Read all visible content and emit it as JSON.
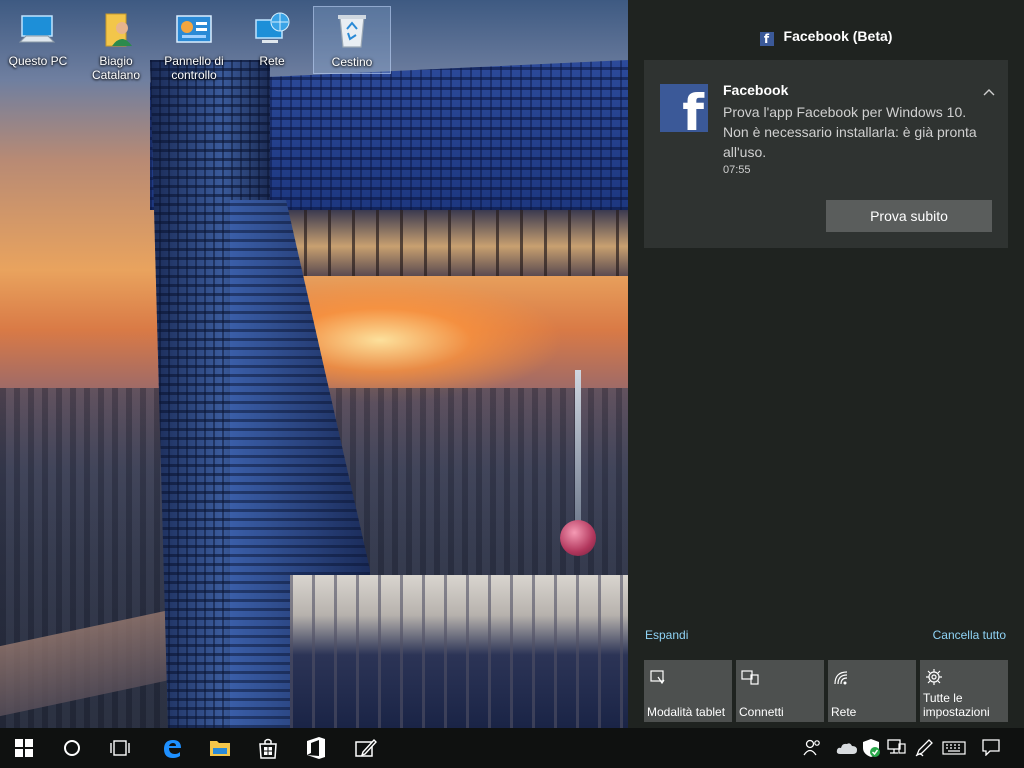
{
  "desktop": {
    "icons": [
      {
        "label": "Questo PC"
      },
      {
        "label": "Biagio\nCatalano"
      },
      {
        "label": "Pannello di controllo"
      },
      {
        "label": "Rete"
      },
      {
        "label": "Cestino"
      }
    ]
  },
  "action_center": {
    "header": {
      "app_name": "Facebook (Beta)",
      "icon": "facebook-icon"
    },
    "notification": {
      "title": "Facebook",
      "body": "Prova l'app Facebook per Windows 10. Non è necessario installarla: è già pronta all'uso.",
      "time": "07:55",
      "button_label": "Prova subito"
    },
    "expand_label": "Espandi",
    "clear_all_label": "Cancella tutto",
    "quick_actions": [
      {
        "label": "Modalità tablet",
        "icon": "tablet-mode-icon"
      },
      {
        "label": "Connetti",
        "icon": "connect-icon"
      },
      {
        "label": "Rete",
        "icon": "network-icon"
      },
      {
        "label": "Tutte le impostazioni",
        "icon": "settings-gear-icon"
      }
    ]
  },
  "taskbar": {
    "pinned": [
      "start-icon",
      "cortana-icon",
      "task-view-icon",
      "edge-icon",
      "file-explorer-icon",
      "store-icon",
      "office-icon",
      "ink-workspace-icon"
    ],
    "tray": [
      "people-icon",
      "onedrive-icon",
      "defender-icon",
      "network-icon",
      "pen-icon",
      "keyboard-icon",
      "action-center-icon"
    ]
  },
  "colors": {
    "accent_link": "#8fd3f5",
    "facebook_blue": "#3b5998",
    "panel_bg": "#1f2320",
    "card_bg": "#2f3331",
    "tile_bg": "#4d504f"
  }
}
